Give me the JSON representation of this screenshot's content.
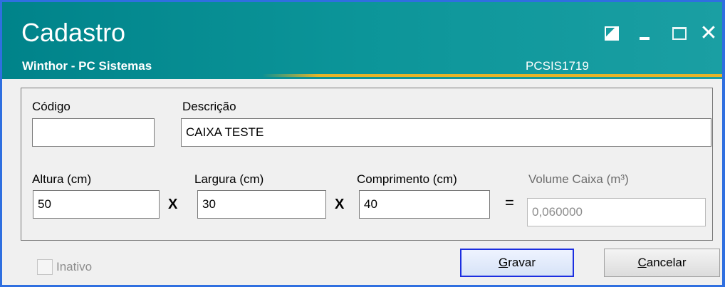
{
  "window": {
    "title": "Cadastro",
    "subtitle": "Winthor - PC Sistemas",
    "code": "PCSIS1719",
    "colors": {
      "titlebar": "#0c9599",
      "accent": "#e6b428",
      "border": "#2f6fe0",
      "focus": "#1c2ee0"
    },
    "controls": [
      "restore-icon",
      "minimize-icon",
      "maximize-icon",
      "close-icon"
    ]
  },
  "form": {
    "codigo": {
      "label": "Código",
      "value": ""
    },
    "descricao": {
      "label": "Descrição",
      "value": "CAIXA TESTE"
    },
    "altura": {
      "label": "Altura (cm)",
      "value": "50"
    },
    "largura": {
      "label": "Largura (cm)",
      "value": "30"
    },
    "comprimento": {
      "label": "Comprimento (cm)",
      "value": "40"
    },
    "volume": {
      "label": "Volume Caixa (m³)",
      "value": "0,060000"
    },
    "times_symbol": "X",
    "equals_symbol": "="
  },
  "footer": {
    "inativo": {
      "label": "Inativo",
      "checked": false,
      "enabled": false
    },
    "gravar": {
      "mnemonic": "G",
      "rest": "ravar"
    },
    "cancelar": {
      "mnemonic": "C",
      "rest": "ancelar"
    }
  }
}
